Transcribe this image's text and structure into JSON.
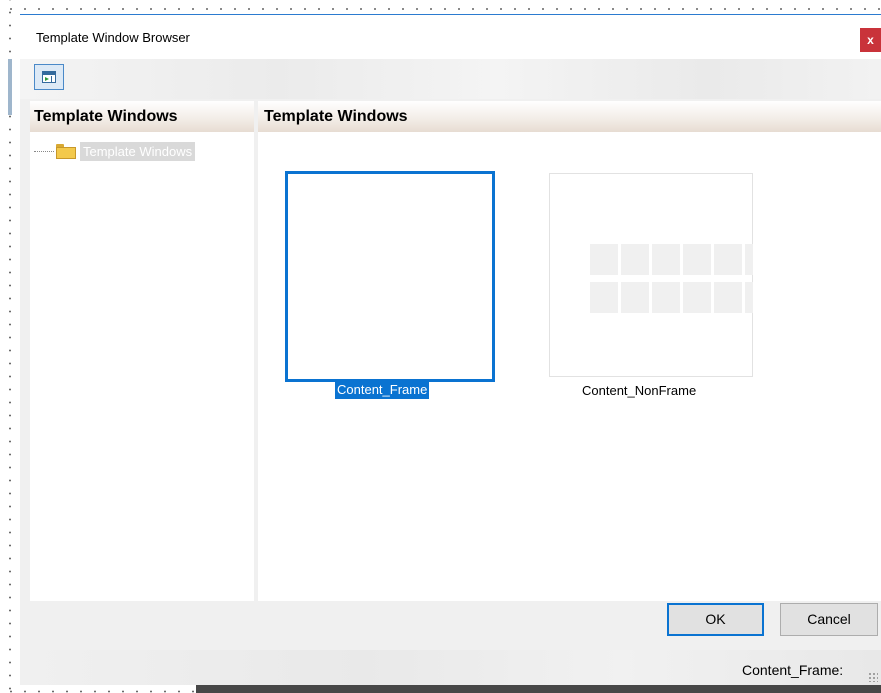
{
  "dialog": {
    "title": "Template Window Browser",
    "close_label": "x"
  },
  "toolbar": {
    "view_icon": "window-view-icon"
  },
  "tree": {
    "header": "Template Windows",
    "items": [
      {
        "label": "Template Windows",
        "icon": "folder-icon"
      }
    ]
  },
  "content": {
    "header": "Template Windows",
    "templates": [
      {
        "label": "Content_Frame",
        "selected": true
      },
      {
        "label": "Content_NonFrame",
        "selected": false
      }
    ]
  },
  "buttons": {
    "ok_label": "OK",
    "cancel_label": "Cancel"
  },
  "status": {
    "text": "Content_Frame:"
  },
  "colors": {
    "accent": "#0a73d1",
    "close": "#c9333a",
    "folder": "#f3c94c"
  }
}
